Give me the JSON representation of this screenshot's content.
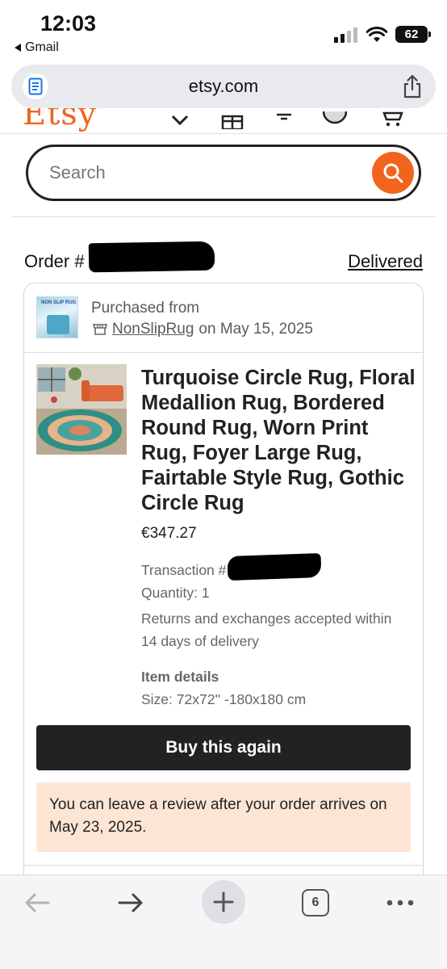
{
  "status_bar": {
    "time": "12:03",
    "back_app": "Gmail",
    "battery": "62"
  },
  "browser": {
    "url": "etsy.com"
  },
  "search": {
    "placeholder": "Search"
  },
  "order": {
    "label": "Order #",
    "status": "Delivered",
    "purchased_from_label": "Purchased from",
    "shop_name": "NonSlipRug",
    "purchase_date_text": "on May 15, 2025",
    "shop_thumb_text": "NON SLIP RUG",
    "item": {
      "title": "Turquoise Circle Rug, Floral Medallion Rug, Bordered Round Rug, Worn Print Rug, Foyer Large Rug, Fairtable Style Rug, Gothic Circle Rug",
      "price": "€347.27",
      "transaction_label": "Transaction #",
      "quantity": "Quantity: 1",
      "returns": "Returns and exchanges accepted within 14 days of delivery",
      "details_heading": "Item details",
      "size": "Size: 72x72'' -180x180 cm"
    },
    "buy_again_label": "Buy this again",
    "review_note": "You can leave a review after your order arrives on May 23, 2025."
  },
  "toolbar": {
    "tab_count": "6"
  },
  "colors": {
    "etsy_orange": "#f1641e",
    "review_bg": "#fde5d6",
    "button_dark": "#222222"
  }
}
